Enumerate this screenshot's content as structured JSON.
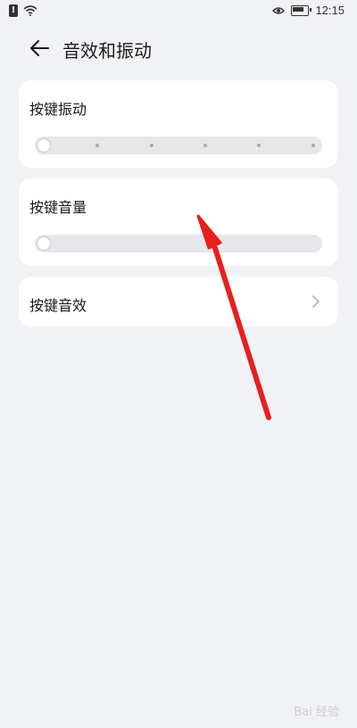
{
  "status_bar": {
    "alert_glyph": "!",
    "time": "12:15",
    "icons": [
      "alert-icon",
      "wifi-icon",
      "eye-icon",
      "battery-icon"
    ]
  },
  "header": {
    "title": "音效和振动",
    "back_icon": "back-arrow-icon"
  },
  "cards": [
    {
      "label": "按键振动",
      "type": "slider",
      "level": 0,
      "steps": 6
    },
    {
      "label": "按键音量",
      "type": "slider",
      "level": 0
    },
    {
      "label": "按键音效",
      "type": "navigation",
      "icon": "chevron-right-icon"
    }
  ],
  "annotation": {
    "color": "#e81f1f",
    "icon": "red-arrow-annotation"
  },
  "watermark": "Bai 经验",
  "colors": {
    "background": "#f1f2f5",
    "card": "#ffffff",
    "track": "#e6e7ea"
  }
}
